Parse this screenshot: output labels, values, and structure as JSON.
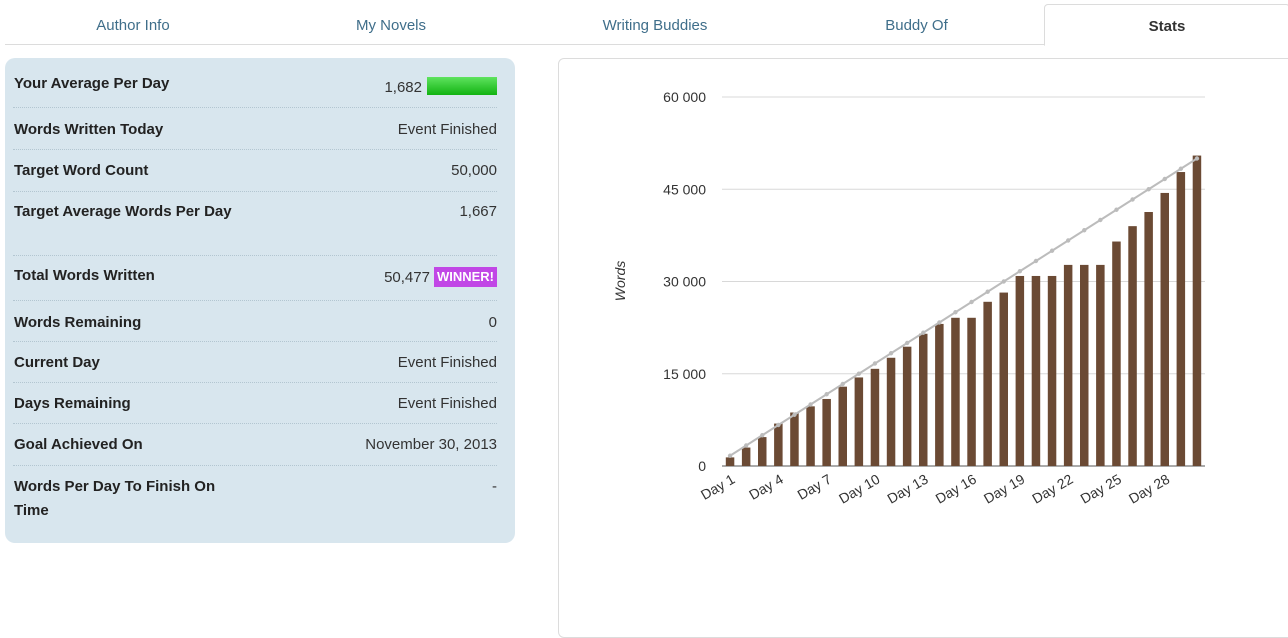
{
  "tabs": [
    {
      "label": "Author Info",
      "active": false
    },
    {
      "label": "My Novels",
      "active": false
    },
    {
      "label": "Writing Buddies",
      "active": false
    },
    {
      "label": "Buddy Of",
      "active": false
    },
    {
      "label": "Stats",
      "active": true
    }
  ],
  "stats": {
    "average_label": "Your Average Per Day",
    "average_value": "1,682",
    "today_label": "Words Written Today",
    "today_value": "Event Finished",
    "target_label": "Target Word Count",
    "target_value": "50,000",
    "target_avg_label": "Target Average Words Per Day",
    "target_avg_value": "1,667",
    "total_label": "Total Words Written",
    "total_value": "50,477",
    "winner_badge": "WINNER!",
    "remaining_label": "Words Remaining",
    "remaining_value": "0",
    "current_day_label": "Current Day",
    "current_day_value": "Event Finished",
    "days_remaining_label": "Days Remaining",
    "days_remaining_value": "Event Finished",
    "goal_label": "Goal Achieved On",
    "goal_value": "November 30, 2013",
    "per_day_finish_label": "Words Per Day To Finish On Time",
    "per_day_finish_value": "-"
  },
  "colors": {
    "bar": "#6b4a34",
    "target_line": "#bcbcbc",
    "winner": "#c147e6",
    "tab_link": "#3f6e8a",
    "panel": "#d8e6ee"
  },
  "chart_data": {
    "type": "bar",
    "title": "",
    "xlabel": "",
    "ylabel": "Words",
    "ylim": [
      0,
      60000
    ],
    "yticks": [
      "0",
      "15 000",
      "30 000",
      "45 000",
      "60 000"
    ],
    "ytick_values": [
      0,
      15000,
      30000,
      45000,
      60000
    ],
    "categories": [
      "Day 1",
      "Day 2",
      "Day 3",
      "Day 4",
      "Day 5",
      "Day 6",
      "Day 7",
      "Day 8",
      "Day 9",
      "Day 10",
      "Day 11",
      "Day 12",
      "Day 13",
      "Day 14",
      "Day 15",
      "Day 16",
      "Day 17",
      "Day 18",
      "Day 19",
      "Day 20",
      "Day 21",
      "Day 22",
      "Day 23",
      "Day 24",
      "Day 25",
      "Day 26",
      "Day 27",
      "Day 28",
      "Day 29",
      "Day 30"
    ],
    "xtick_labels": [
      "Day 1",
      "Day 4",
      "Day 7",
      "Day 10",
      "Day 13",
      "Day 16",
      "Day 19",
      "Day 22",
      "Day 25",
      "Day 28"
    ],
    "values": [
      1400,
      3000,
      4700,
      6900,
      8700,
      9700,
      10900,
      12900,
      14400,
      15800,
      17600,
      19400,
      21500,
      23100,
      24100,
      24100,
      26700,
      28200,
      30900,
      30900,
      30900,
      32700,
      32700,
      32700,
      36500,
      39000,
      41300,
      44400,
      47800,
      50477
    ],
    "target_line": [
      1667,
      3333,
      5000,
      6667,
      8333,
      10000,
      11667,
      13333,
      15000,
      16667,
      18333,
      20000,
      21667,
      23333,
      25000,
      26667,
      28333,
      30000,
      31667,
      33333,
      35000,
      36667,
      38333,
      40000,
      41667,
      43333,
      45000,
      46667,
      48333,
      50000
    ],
    "grid": true
  }
}
